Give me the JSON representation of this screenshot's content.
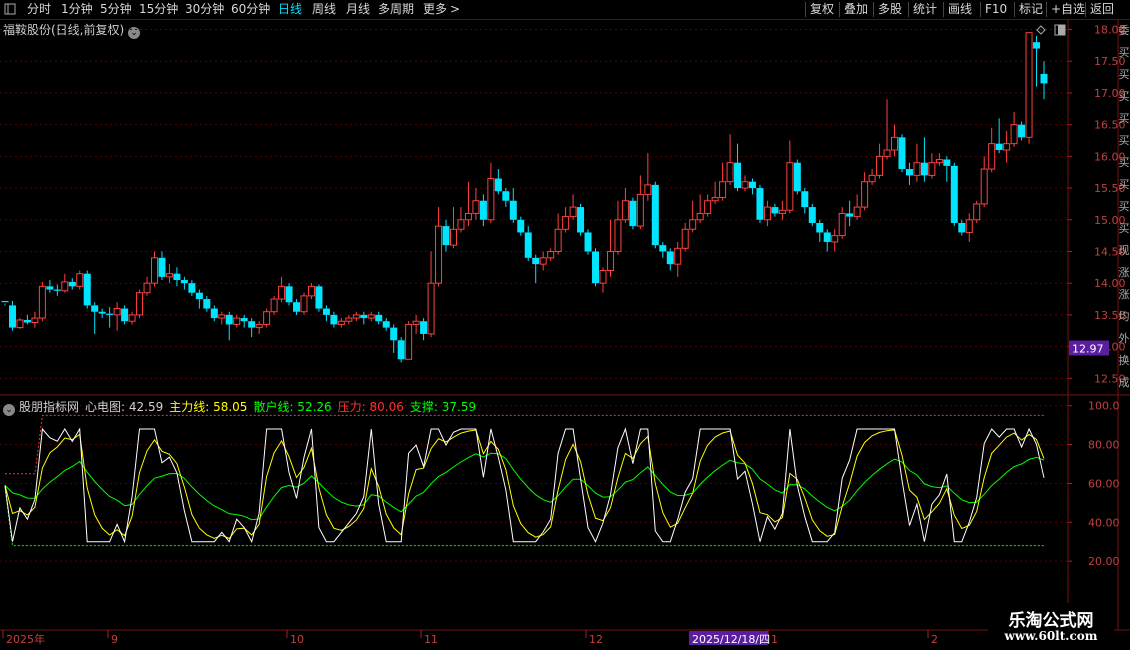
{
  "toolbar": {
    "periods": [
      {
        "label": "分时",
        "active": false
      },
      {
        "label": "1分钟",
        "active": false
      },
      {
        "label": "5分钟",
        "active": false
      },
      {
        "label": "15分钟",
        "active": false
      },
      {
        "label": "30分钟",
        "active": false
      },
      {
        "label": "60分钟",
        "active": false
      },
      {
        "label": "日线",
        "active": true
      },
      {
        "label": "周线",
        "active": false
      },
      {
        "label": "月线",
        "active": false
      },
      {
        "label": "多周期",
        "active": false
      },
      {
        "label": "更多",
        "active": false
      }
    ],
    "tools": [
      "复权",
      "叠加",
      "多股",
      "统计",
      "画线",
      "F10",
      "标记",
      "+自选",
      "返回"
    ]
  },
  "stock": {
    "name": "福鞍股份(日线,前复权)"
  },
  "price_axis": {
    "labels": [
      "18.00",
      "17.50",
      "17.00",
      "16.50",
      "16.00",
      "15.50",
      "15.00",
      "14.50",
      "14.00",
      "13.50",
      "13.00",
      "12.50"
    ],
    "current": "12.97",
    "current_color": "#5a1fa0"
  },
  "indicator": {
    "name": "股朋指标网",
    "items": [
      {
        "label": "心电图:",
        "value": "42.59",
        "color": "#ffffff"
      },
      {
        "label": "主力线:",
        "value": "58.05",
        "color": "#ffff00"
      },
      {
        "label": "散户线:",
        "value": "52.26",
        "color": "#00ff00"
      },
      {
        "label": "压力:",
        "value": "80.06",
        "color": "#ff3030"
      },
      {
        "label": "支撑:",
        "value": "37.59",
        "color": "#00ff00"
      }
    ],
    "axis_labels": [
      "100.0",
      "80.00",
      "60.00",
      "40.00",
      "20.00"
    ]
  },
  "date_axis": {
    "labels": [
      "2025年",
      "9",
      "10",
      "11",
      "12",
      "1",
      "2"
    ],
    "cursor": "2025/12/18/四"
  },
  "side_strip": {
    "chars": [
      "委",
      "买",
      "买",
      "买",
      "买",
      "买",
      "买",
      "买",
      "买",
      "买",
      "现",
      "涨",
      "涨",
      "均",
      "外",
      "换",
      "成"
    ]
  },
  "watermark": {
    "line1": "乐淘公式网",
    "line2": "www.60lt.com"
  },
  "colors": {
    "up": "#ff4040",
    "down": "#00e5ff",
    "grid": "#5a0000"
  },
  "chart_data": {
    "type": "candlestick",
    "title": "福鞍股份(日线,前复权)",
    "ylim": [
      12.3,
      18.15
    ],
    "last_close": 12.97,
    "candles": [
      [
        13.72,
        13.7,
        13.65,
        13.68
      ],
      [
        13.65,
        13.3,
        13.72,
        13.25
      ],
      [
        13.3,
        13.42,
        13.28,
        13.45
      ],
      [
        13.42,
        13.38,
        13.35,
        13.5
      ],
      [
        13.38,
        13.45,
        13.3,
        13.55
      ],
      [
        13.45,
        13.95,
        13.4,
        14.02
      ],
      [
        13.95,
        13.9,
        13.85,
        14.05
      ],
      [
        13.9,
        13.88,
        13.8,
        13.98
      ],
      [
        13.88,
        14.02,
        13.85,
        14.15
      ],
      [
        14.02,
        13.95,
        13.9,
        14.08
      ],
      [
        13.95,
        14.15,
        13.9,
        14.2
      ],
      [
        14.15,
        13.65,
        13.6,
        14.2
      ],
      [
        13.65,
        13.55,
        13.2,
        13.7
      ],
      [
        13.55,
        13.52,
        13.45,
        13.6
      ],
      [
        13.52,
        13.5,
        13.3,
        13.62
      ],
      [
        13.5,
        13.6,
        13.25,
        13.7
      ],
      [
        13.6,
        13.4,
        13.35,
        13.65
      ],
      [
        13.4,
        13.5,
        13.35,
        13.55
      ],
      [
        13.5,
        13.85,
        13.45,
        13.9
      ],
      [
        13.85,
        14.0,
        13.8,
        14.1
      ],
      [
        14.0,
        14.4,
        13.95,
        14.5
      ],
      [
        14.4,
        14.1,
        14.05,
        14.5
      ],
      [
        14.1,
        14.15,
        14.0,
        14.3
      ],
      [
        14.15,
        14.05,
        13.95,
        14.25
      ],
      [
        14.05,
        14.0,
        13.9,
        14.1
      ],
      [
        14.0,
        13.85,
        13.8,
        14.05
      ],
      [
        13.85,
        13.75,
        13.6,
        13.9
      ],
      [
        13.75,
        13.6,
        13.55,
        13.8
      ],
      [
        13.6,
        13.45,
        13.4,
        13.65
      ],
      [
        13.45,
        13.5,
        13.35,
        13.55
      ],
      [
        13.5,
        13.35,
        13.1,
        13.55
      ],
      [
        13.35,
        13.45,
        13.3,
        13.5
      ],
      [
        13.45,
        13.4,
        13.3,
        13.5
      ],
      [
        13.4,
        13.3,
        13.15,
        13.45
      ],
      [
        13.3,
        13.35,
        13.2,
        13.4
      ],
      [
        13.35,
        13.55,
        13.3,
        13.6
      ],
      [
        13.55,
        13.75,
        13.5,
        13.8
      ],
      [
        13.75,
        13.95,
        13.7,
        14.1
      ],
      [
        13.95,
        13.7,
        13.65,
        14.0
      ],
      [
        13.7,
        13.55,
        13.5,
        13.75
      ],
      [
        13.55,
        13.8,
        13.5,
        13.85
      ],
      [
        13.8,
        13.95,
        13.75,
        14.0
      ],
      [
        13.95,
        13.6,
        13.55,
        13.98
      ],
      [
        13.6,
        13.5,
        13.4,
        13.65
      ],
      [
        13.5,
        13.35,
        13.3,
        13.55
      ],
      [
        13.35,
        13.4,
        13.3,
        13.45
      ],
      [
        13.4,
        13.45,
        13.35,
        13.5
      ],
      [
        13.45,
        13.5,
        13.4,
        13.55
      ],
      [
        13.5,
        13.45,
        13.35,
        13.55
      ],
      [
        13.45,
        13.5,
        13.4,
        13.55
      ],
      [
        13.5,
        13.4,
        13.35,
        13.55
      ],
      [
        13.4,
        13.3,
        13.25,
        13.45
      ],
      [
        13.3,
        13.1,
        12.9,
        13.35
      ],
      [
        13.1,
        12.8,
        12.75,
        13.15
      ],
      [
        12.8,
        13.35,
        12.8,
        13.4
      ],
      [
        13.35,
        13.4,
        13.2,
        13.5
      ],
      [
        13.4,
        13.2,
        13.1,
        13.45
      ],
      [
        13.2,
        14.0,
        13.15,
        14.5
      ],
      [
        14.0,
        14.9,
        13.95,
        15.2
      ],
      [
        14.9,
        14.6,
        14.5,
        15.0
      ],
      [
        14.6,
        14.85,
        14.55,
        15.2
      ],
      [
        14.85,
        15.0,
        14.8,
        15.2
      ],
      [
        15.0,
        15.1,
        14.9,
        15.6
      ],
      [
        15.1,
        15.3,
        15.0,
        15.5
      ],
      [
        15.3,
        15.0,
        14.9,
        15.4
      ],
      [
        15.0,
        15.65,
        14.95,
        15.9
      ],
      [
        15.65,
        15.45,
        15.4,
        15.8
      ],
      [
        15.45,
        15.3,
        15.2,
        15.5
      ],
      [
        15.3,
        15.0,
        14.95,
        15.5
      ],
      [
        15.0,
        14.8,
        14.75,
        15.05
      ],
      [
        14.8,
        14.4,
        14.35,
        14.9
      ],
      [
        14.4,
        14.3,
        14.0,
        14.45
      ],
      [
        14.3,
        14.4,
        14.2,
        14.5
      ],
      [
        14.4,
        14.5,
        14.35,
        14.55
      ],
      [
        14.5,
        14.85,
        14.45,
        15.1
      ],
      [
        14.85,
        15.05,
        14.8,
        15.2
      ],
      [
        15.05,
        15.2,
        15.0,
        15.4
      ],
      [
        15.2,
        14.8,
        14.75,
        15.25
      ],
      [
        14.8,
        14.5,
        14.45,
        14.85
      ],
      [
        14.5,
        14.0,
        13.95,
        14.55
      ],
      [
        14.0,
        14.2,
        13.85,
        14.25
      ],
      [
        14.2,
        14.5,
        14.1,
        15.0
      ],
      [
        14.5,
        15.0,
        14.45,
        15.3
      ],
      [
        15.0,
        15.3,
        14.95,
        15.5
      ],
      [
        15.3,
        14.9,
        14.85,
        15.35
      ],
      [
        14.9,
        15.4,
        14.85,
        15.7
      ],
      [
        15.4,
        15.55,
        15.3,
        16.05
      ],
      [
        15.55,
        14.6,
        14.55,
        15.6
      ],
      [
        14.6,
        14.5,
        14.4,
        14.65
      ],
      [
        14.5,
        14.3,
        14.2,
        14.55
      ],
      [
        14.3,
        14.55,
        14.1,
        14.65
      ],
      [
        14.55,
        14.85,
        14.5,
        14.95
      ],
      [
        14.85,
        15.0,
        14.8,
        15.3
      ],
      [
        15.0,
        15.1,
        14.95,
        15.4
      ],
      [
        15.1,
        15.3,
        15.05,
        15.4
      ],
      [
        15.3,
        15.35,
        15.25,
        15.6
      ],
      [
        15.35,
        15.6,
        15.3,
        15.9
      ],
      [
        15.6,
        15.9,
        15.55,
        16.35
      ],
      [
        15.9,
        15.5,
        15.45,
        16.2
      ],
      [
        15.5,
        15.6,
        15.45,
        15.7
      ],
      [
        15.6,
        15.5,
        15.4,
        15.65
      ],
      [
        15.5,
        15.0,
        14.95,
        15.55
      ],
      [
        15.0,
        15.2,
        14.9,
        15.3
      ],
      [
        15.2,
        15.1,
        15.05,
        15.25
      ],
      [
        15.1,
        15.15,
        15.0,
        15.3
      ],
      [
        15.15,
        15.9,
        15.1,
        16.25
      ],
      [
        15.9,
        15.45,
        15.4,
        15.95
      ],
      [
        15.45,
        15.2,
        15.1,
        15.5
      ],
      [
        15.2,
        14.95,
        14.9,
        15.25
      ],
      [
        14.95,
        14.8,
        14.65,
        15.0
      ],
      [
        14.8,
        14.65,
        14.5,
        14.85
      ],
      [
        14.65,
        14.75,
        14.5,
        14.85
      ],
      [
        14.75,
        15.1,
        14.7,
        15.2
      ],
      [
        15.1,
        15.05,
        14.9,
        15.3
      ],
      [
        15.05,
        15.2,
        15.0,
        15.4
      ],
      [
        15.2,
        15.6,
        15.15,
        15.75
      ],
      [
        15.6,
        15.7,
        15.55,
        15.8
      ],
      [
        15.7,
        16.0,
        15.65,
        16.2
      ],
      [
        16.0,
        16.1,
        15.95,
        16.9
      ],
      [
        16.1,
        16.3,
        16.0,
        16.5
      ],
      [
        16.3,
        15.8,
        15.75,
        16.35
      ],
      [
        15.8,
        15.7,
        15.55,
        15.9
      ],
      [
        15.7,
        15.9,
        15.6,
        16.2
      ],
      [
        15.9,
        15.7,
        15.6,
        16.3
      ],
      [
        15.7,
        15.9,
        15.65,
        16.05
      ],
      [
        15.9,
        15.95,
        15.85,
        16.05
      ],
      [
        15.95,
        15.85,
        15.6,
        16.0
      ],
      [
        15.85,
        14.95,
        14.9,
        15.9
      ],
      [
        14.95,
        14.8,
        14.75,
        15.0
      ],
      [
        14.8,
        15.0,
        14.65,
        15.1
      ],
      [
        15.0,
        15.25,
        14.95,
        15.3
      ],
      [
        15.25,
        15.8,
        15.2,
        16.0
      ],
      [
        15.8,
        16.2,
        15.75,
        16.45
      ],
      [
        16.2,
        16.1,
        16.05,
        16.6
      ],
      [
        16.1,
        16.2,
        15.9,
        16.4
      ],
      [
        16.2,
        16.5,
        16.15,
        16.7
      ],
      [
        16.5,
        16.3,
        16.25,
        16.55
      ],
      [
        16.3,
        17.95,
        16.2,
        17.95
      ],
      [
        17.8,
        17.7,
        17.1,
        17.9
      ],
      [
        17.3,
        17.15,
        16.9,
        17.5
      ]
    ],
    "indicator_series": {
      "ylim": [
        0,
        105
      ],
      "series": [
        {
          "name": "心电图",
          "color": "#ffffff"
        },
        {
          "name": "主力线",
          "color": "#ffff00"
        },
        {
          "name": "散户线",
          "color": "#00ff00"
        },
        {
          "name": "压力",
          "color": "#ff3030"
        },
        {
          "name": "支撑",
          "color": "#00ff00"
        }
      ]
    }
  }
}
